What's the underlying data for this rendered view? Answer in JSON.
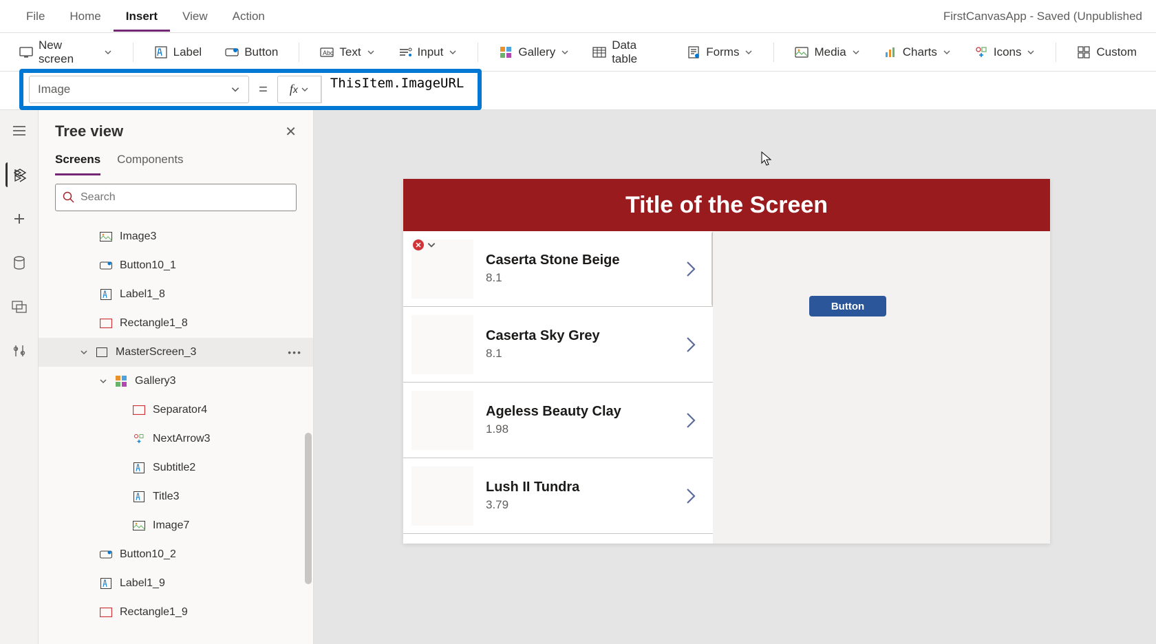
{
  "app": {
    "status": "FirstCanvasApp - Saved (Unpublished"
  },
  "menubar": {
    "file": "File",
    "home": "Home",
    "insert": "Insert",
    "view": "View",
    "action": "Action"
  },
  "ribbon": {
    "new_screen": "New screen",
    "label": "Label",
    "button": "Button",
    "text": "Text",
    "input": "Input",
    "gallery": "Gallery",
    "data_table": "Data table",
    "forms": "Forms",
    "media": "Media",
    "charts": "Charts",
    "icons": "Icons",
    "custom": "Custom"
  },
  "formula": {
    "property": "Image",
    "equals": "=",
    "expression": "ThisItem.ImageURL"
  },
  "tree": {
    "title": "Tree view",
    "tabs": {
      "screens": "Screens",
      "components": "Components"
    },
    "search_placeholder": "Search",
    "items": {
      "image3": "Image3",
      "button10_1": "Button10_1",
      "label1_8": "Label1_8",
      "rectangle1_8": "Rectangle1_8",
      "masterscreen_3": "MasterScreen_3",
      "gallery3": "Gallery3",
      "separator4": "Separator4",
      "nextarrow3": "NextArrow3",
      "subtitle2": "Subtitle2",
      "title3": "Title3",
      "image7": "Image7",
      "button10_2": "Button10_2",
      "label1_9": "Label1_9",
      "rectangle1_9": "Rectangle1_9"
    }
  },
  "canvas": {
    "header_title": "Title of the Screen",
    "button_label": "Button",
    "gallery_items": [
      {
        "title": "Caserta Stone Beige",
        "subtitle": "8.1"
      },
      {
        "title": "Caserta Sky Grey",
        "subtitle": "8.1"
      },
      {
        "title": "Ageless Beauty Clay",
        "subtitle": "1.98"
      },
      {
        "title": "Lush II Tundra",
        "subtitle": "3.79"
      }
    ]
  }
}
